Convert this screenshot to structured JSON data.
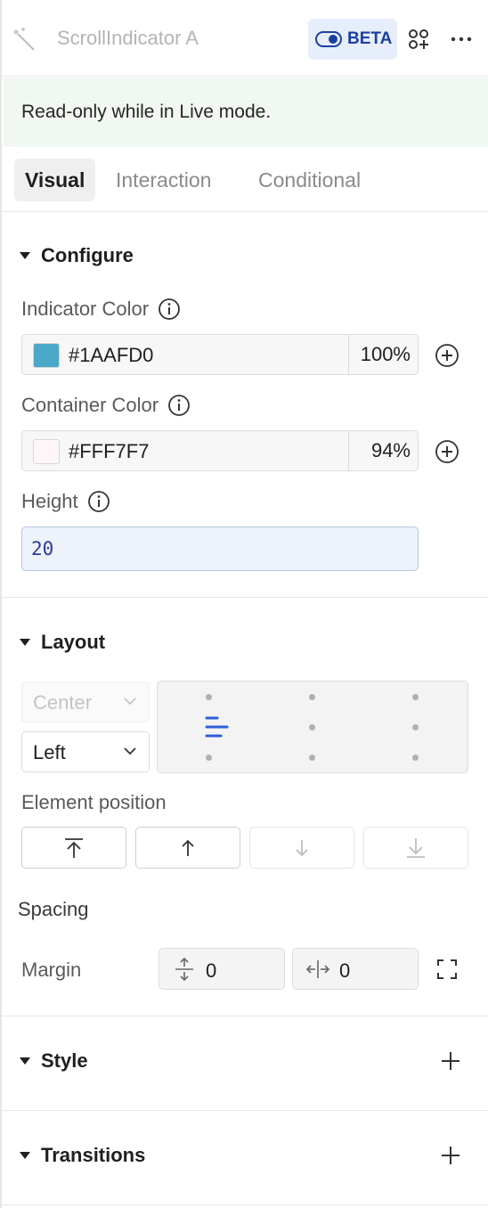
{
  "header": {
    "title": "ScrollIndicator A",
    "beta_label": "BETA",
    "icons": [
      "magic-wand-icon",
      "toggle-icon",
      "components-icon",
      "more-icon"
    ]
  },
  "banner": {
    "text": "Read-only while in Live mode."
  },
  "tabs": [
    {
      "label": "Visual",
      "active": true
    },
    {
      "label": "Interaction",
      "active": false
    },
    {
      "label": "Conditional",
      "active": false
    }
  ],
  "configure": {
    "title": "Configure",
    "indicator_color": {
      "label": "Indicator Color",
      "hex": "#1AAFD0",
      "swatch": "#4aa8c9",
      "opacity": "100%"
    },
    "container_color": {
      "label": "Container Color",
      "hex": "#FFF7F7",
      "swatch": "#fff7f7",
      "opacity": "94%"
    },
    "height": {
      "label": "Height",
      "value": "20"
    }
  },
  "layout": {
    "title": "Layout",
    "vertical_select": "Center",
    "horizontal_select": "Left",
    "element_position_label": "Element position",
    "spacing_label": "Spacing",
    "margin_label": "Margin",
    "margin_vertical": "0",
    "margin_horizontal": "0"
  },
  "style": {
    "title": "Style"
  },
  "transitions": {
    "title": "Transitions"
  },
  "colors": {
    "accent": "#2f5fd8",
    "beta_bg": "#e7eefb",
    "banner_bg": "#f1f7f1"
  }
}
